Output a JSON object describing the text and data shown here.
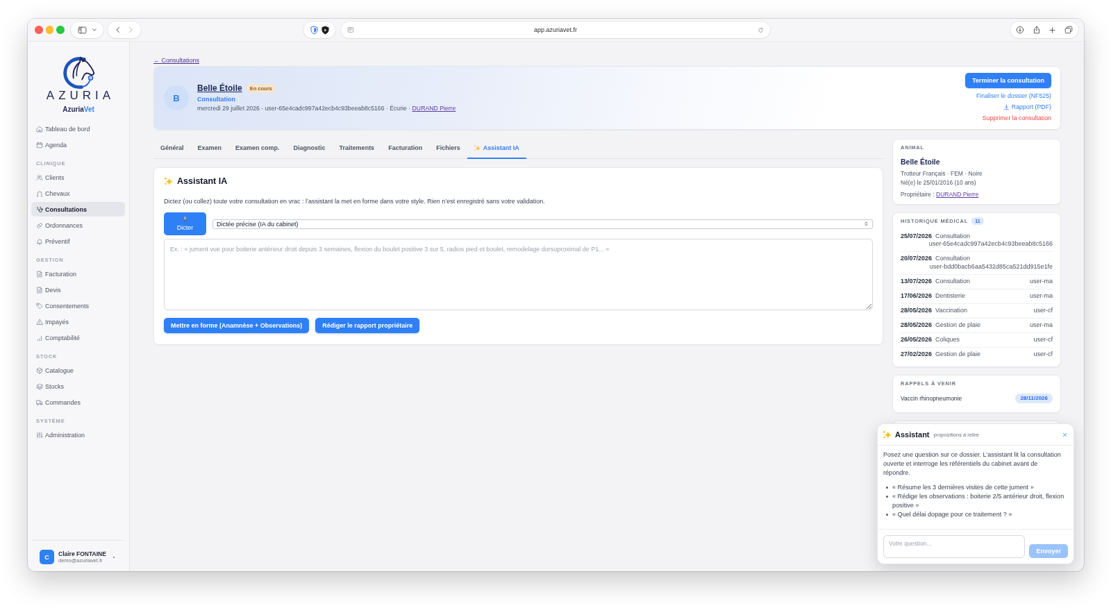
{
  "browser": {
    "url": "app.azuriavet.fr"
  },
  "sidebar": {
    "brand": {
      "wordmark": "AZURIA",
      "name": "Azuria",
      "name_accent": "Vet"
    },
    "sections": [
      {
        "items": [
          {
            "label": "Tableau de bord",
            "selected": false
          },
          {
            "label": "Agenda",
            "selected": false
          }
        ]
      },
      {
        "heading": "CLINIQUE",
        "items": [
          {
            "label": "Clients",
            "selected": false
          },
          {
            "label": "Chevaux",
            "selected": false
          },
          {
            "label": "Consultations",
            "selected": true
          },
          {
            "label": "Ordonnances",
            "selected": false
          },
          {
            "label": "Préventif",
            "selected": false
          }
        ]
      },
      {
        "heading": "GESTION",
        "items": [
          {
            "label": "Facturation",
            "selected": false
          },
          {
            "label": "Devis",
            "selected": false
          },
          {
            "label": "Consentements",
            "selected": false
          },
          {
            "label": "Impayés",
            "selected": false
          },
          {
            "label": "Comptabilité",
            "selected": false
          }
        ]
      },
      {
        "heading": "STOCK",
        "items": [
          {
            "label": "Catalogue",
            "selected": false
          },
          {
            "label": "Stocks",
            "selected": false
          },
          {
            "label": "Commandes",
            "selected": false
          }
        ]
      },
      {
        "heading": "SYSTÈME",
        "items": [
          {
            "label": "Administration",
            "selected": false
          }
        ]
      }
    ],
    "user": {
      "initial": "C",
      "name": "Claire FONTAINE",
      "email": "demo@azuriavet.fr"
    }
  },
  "breadcrumb": {
    "label": "← Consultations"
  },
  "header": {
    "avatar": "B",
    "name": "Belle Étoile",
    "status": "En cours",
    "type": "Consultation",
    "meta": "mercredi 29 juillet 2026 · user-65e4cadc997a42ecb4c93beeab8c5166 · Écurie ·",
    "owner": "DURAND Pierre",
    "primary_action": "Terminer la consultation",
    "actions": [
      {
        "label": "Finaliser le dossier (NF525)",
        "kind": "link"
      },
      {
        "label": "Rapport (PDF)",
        "kind": "download"
      },
      {
        "label": "Supprimer la consultation",
        "kind": "danger"
      }
    ]
  },
  "tabs": [
    {
      "label": "Général",
      "kind": "standard",
      "selected": false
    },
    {
      "label": "Examen",
      "kind": "standard",
      "selected": false
    },
    {
      "label": "Examen comp.",
      "kind": "standard",
      "selected": false
    },
    {
      "label": "Diagnostic",
      "kind": "standard",
      "selected": false
    },
    {
      "label": "Traitements",
      "kind": "standard",
      "selected": false
    },
    {
      "label": "Facturation",
      "kind": "standard",
      "selected": false
    },
    {
      "label": "Fichiers",
      "kind": "standard",
      "selected": false
    },
    {
      "label": "Assistant IA",
      "kind": "assistant",
      "selected": true
    }
  ],
  "assistant_panel": {
    "title": "Assistant IA",
    "description": "Dictez (ou collez) toute votre consultation en vrac : l’assistant la met en forme dans votre style. Rien n’est enregistré sans votre validation.",
    "dictate_button": "Dicter",
    "mode_select": {
      "value": "Dictée précise (IA du cabinet)"
    },
    "dictation_input": {
      "placeholder": "Ex. : « jument vue pour boiterie antérieur droit depuis 3 semaines, flexion du boulet positive 3 sur 5, radios pied et boulet, remodelage dorsoproximal de P1... »"
    },
    "buttons": [
      "Mettre en forme (Anamnèse + Observations)",
      "Rédiger le rapport propriétaire"
    ]
  },
  "animal": {
    "heading": "ANIMAL",
    "name": "Belle Étoile",
    "details": [
      "Trotteur Français · FEM · Noire",
      "Né(e) le 25/01/2016 (10 ans)"
    ],
    "owner_label": "Propriétaire :",
    "owner": "DURAND Pierre"
  },
  "history": {
    "heading": "HISTORIQUE MÉDICAL",
    "count": "11",
    "rows": [
      {
        "date": "25/07/2026",
        "type": "Consultation",
        "user": "user-65e4cadc997a42ecb4c93beeab8c5166"
      },
      {
        "date": "20/07/2026",
        "type": "Consultation",
        "user": "user-bdd0bacb6aa5432d85ca521dd915e1fe"
      },
      {
        "date": "13/07/2026",
        "type": "Consultation",
        "user": "user-ma"
      },
      {
        "date": "17/06/2026",
        "type": "Dentisterie",
        "user": "user-ma"
      },
      {
        "date": "28/05/2026",
        "type": "Vaccination",
        "user": "user-cf"
      },
      {
        "date": "28/05/2026",
        "type": "Gestion de plaie",
        "user": "user-ma"
      },
      {
        "date": "26/05/2026",
        "type": "Coliques",
        "user": "user-cf"
      },
      {
        "date": "27/02/2026",
        "type": "Gestion de plaie",
        "user": "user-cf"
      }
    ]
  },
  "reminders": {
    "heading": "RAPPELS À VENIR",
    "items": [
      {
        "label": "Vaccin rhinopneumonie",
        "date": "28/11/2026"
      }
    ]
  },
  "chat": {
    "title": "Assistant",
    "subtitle": "propositions à relire",
    "intro": "Posez une question sur ce dossier. L’assistant lit la consultation ouverte et interroge les référentiels du cabinet avant de répondre.",
    "suggestions": [
      "« Résume les 3 dernières visites de cette jument »",
      "« Rédige les observations : boiterie 2/5 antérieur droit, flexion positive »",
      "« Quel délai dopage pour ce traitement ? »"
    ],
    "question_input": {
      "placeholder": "Votre question..."
    },
    "send_button": {
      "label": "Envoyer",
      "disabled": true
    }
  }
}
